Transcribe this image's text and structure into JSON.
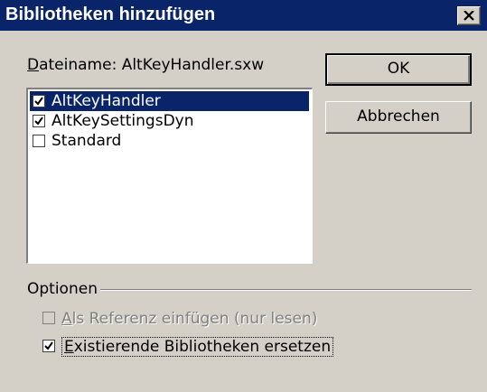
{
  "dialog": {
    "title": "Bibliotheken hinzufügen",
    "file_label_accel": "D",
    "file_label_rest": "ateiname: AltKeyHandler.sxw"
  },
  "libraries": [
    {
      "label": "AltKeyHandler",
      "checked": true,
      "selected": true
    },
    {
      "label": "AltKeySettingsDyn",
      "checked": true,
      "selected": false
    },
    {
      "label": "Standard",
      "checked": false,
      "selected": false
    }
  ],
  "buttons": {
    "ok": "OK",
    "cancel": "Abbrechen"
  },
  "options": {
    "group_label": "Optionen",
    "reference": {
      "accel": "A",
      "rest": "ls Referenz einfügen (nur lesen)",
      "checked": false,
      "enabled": false
    },
    "replace": {
      "accel": "E",
      "rest": "xistierende Bibliotheken ersetzen",
      "checked": true,
      "enabled": true
    }
  },
  "colors": {
    "titlebar": "#0a246a",
    "selection": "#0a246a",
    "face": "#d4d0c8"
  }
}
